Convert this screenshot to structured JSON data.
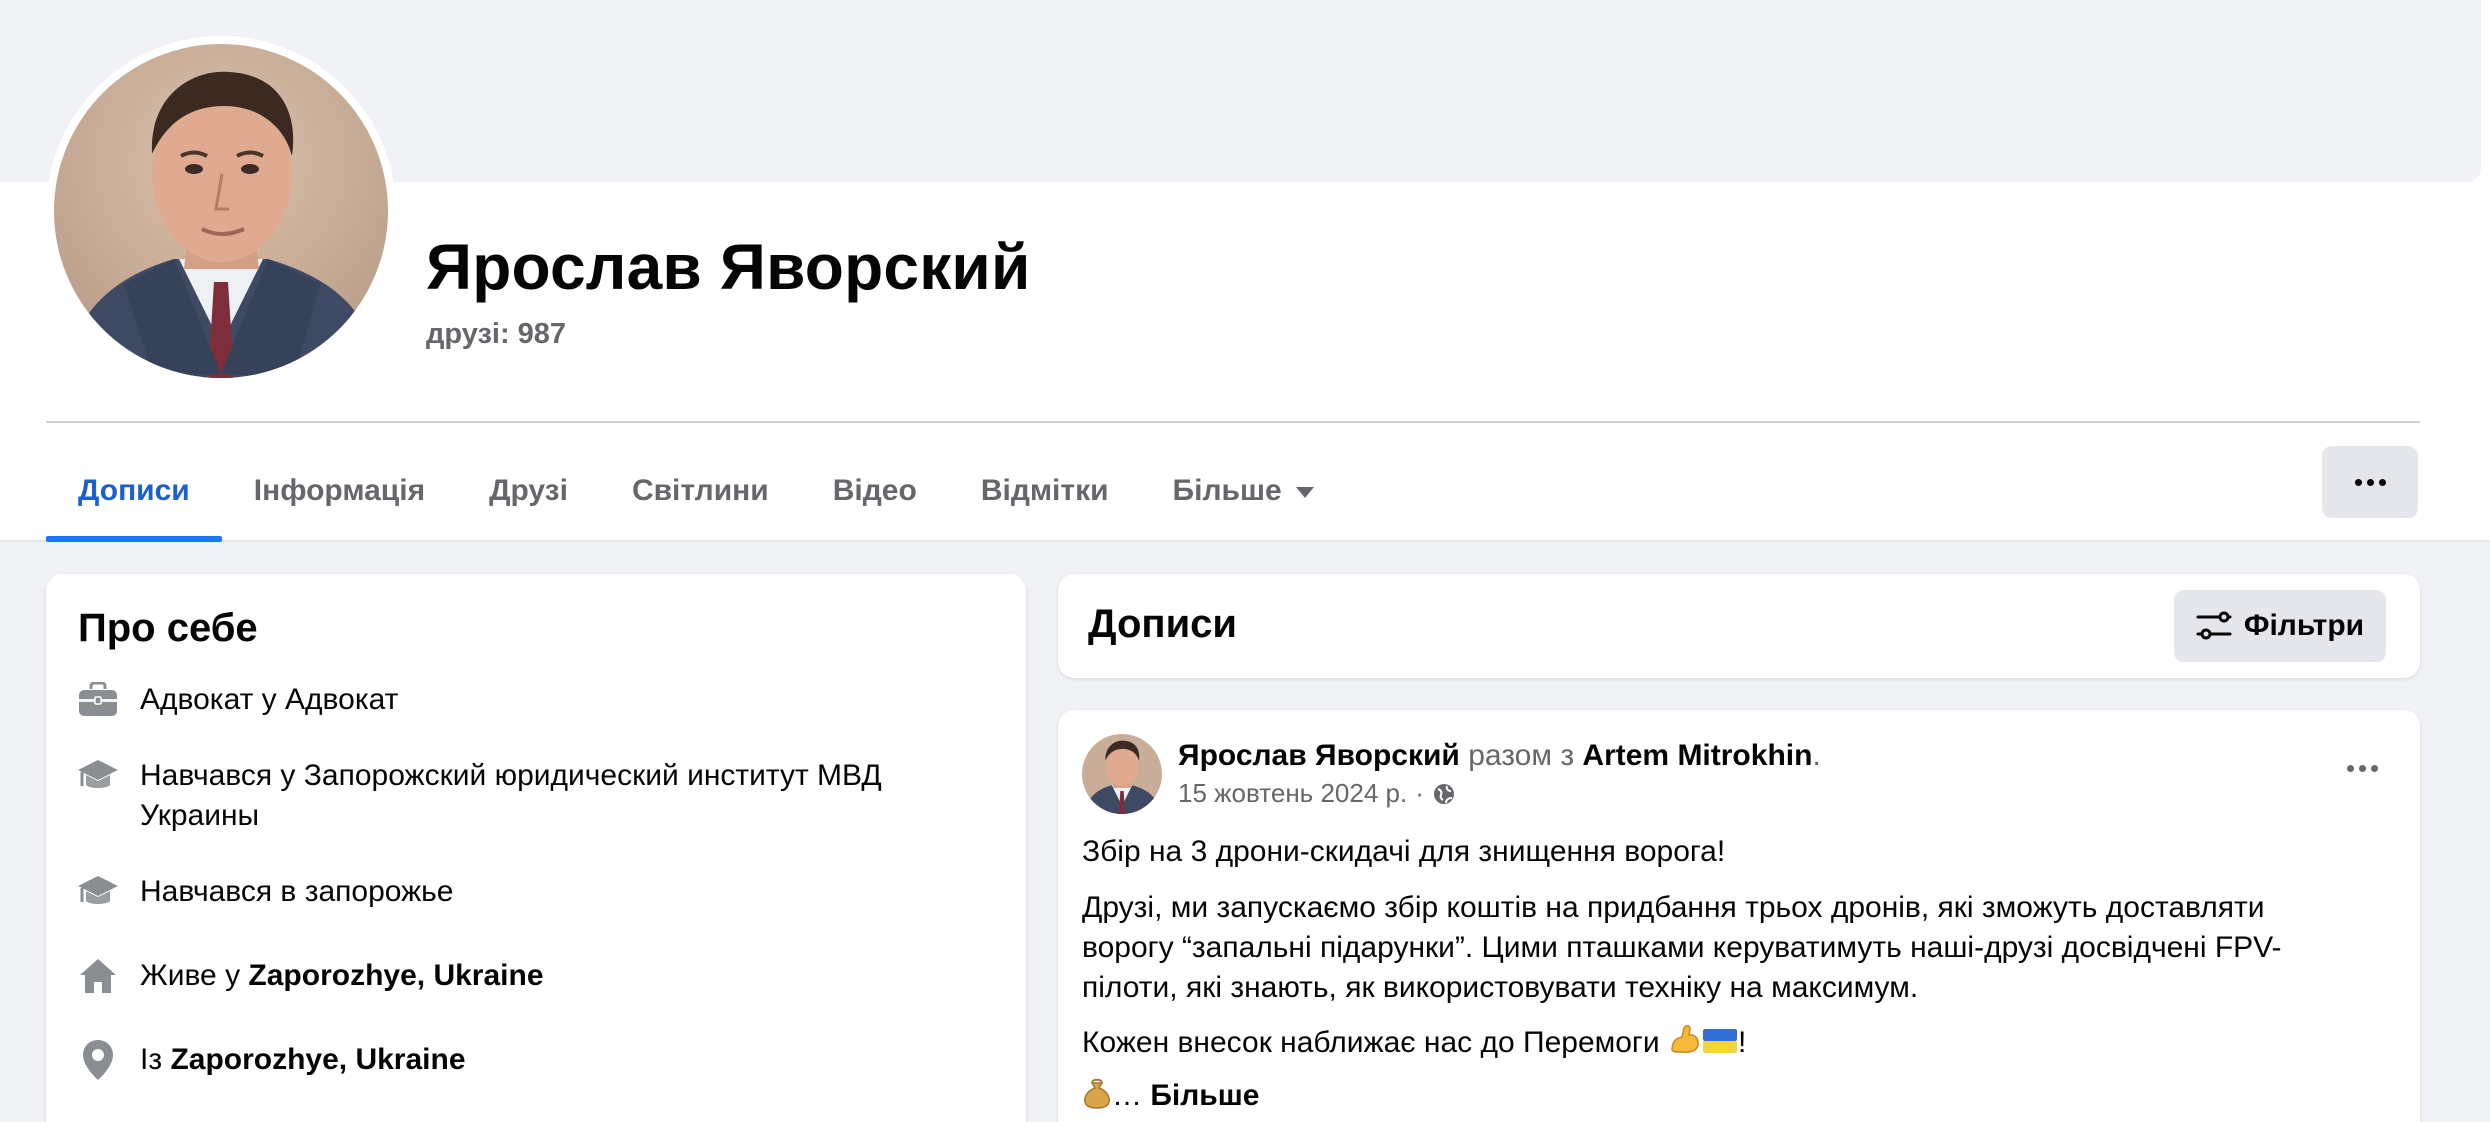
{
  "profile": {
    "name": "Ярослав Яворский",
    "friends": "друзі: 987"
  },
  "tabs": [
    {
      "label": "Дописи",
      "active": true
    },
    {
      "label": "Інформація",
      "active": false
    },
    {
      "label": "Друзі",
      "active": false
    },
    {
      "label": "Світлини",
      "active": false
    },
    {
      "label": "Відео",
      "active": false
    },
    {
      "label": "Відмітки",
      "active": false
    },
    {
      "label": "Більше",
      "active": false
    }
  ],
  "about": {
    "title": "Про себе",
    "items": [
      {
        "icon": "briefcase-icon",
        "text": "Адвокат у Адвокат"
      },
      {
        "icon": "graduation-cap-icon",
        "text": "Навчався у Запорожский юридический институт МВД",
        "text2": "Украины"
      },
      {
        "icon": "graduation-cap-icon",
        "text": "Навчався в запорожье"
      },
      {
        "icon": "home-icon",
        "prefix": "Живе у ",
        "bold": "Zaporozhye, Ukraine"
      },
      {
        "icon": "location-pin-icon",
        "prefix": "Із ",
        "bold": "Zaporozhye, Ukraine"
      }
    ]
  },
  "posts": {
    "title": "Дописи",
    "filters_label": "Фільтри"
  },
  "post": {
    "author": "Ярослав Яворский",
    "with_text": "разом з",
    "tagged": "Artem Mitrokhin",
    "period": ".",
    "date": "15 жовтень 2024 р.",
    "dot": "·",
    "audience_icon": "globe-icon",
    "line1": "Збір на 3 дрони-скидачі для знищення ворога!",
    "para1": [
      "Друзі, ми запускаємо збір коштів на придбання трьох дронів, які зможуть доставляти",
      "ворогу “запальні підарунки”. Цими пташками керуватимуть наші-друзі досвідчені FPV-",
      "пілоти, які знають, як використовувати техніку на максимум."
    ],
    "line3": "Кожен внесок наближає нас до Перемоги ",
    "line3_end": "!",
    "ellipsis": "… ",
    "see_more": "Більше"
  },
  "colors": {
    "accent": "#1877f2",
    "active_tab_text": "#1b5fd1",
    "muted_text": "#65676b",
    "page_bg": "#f0f2f5",
    "button_bg": "#e4e6eb"
  }
}
